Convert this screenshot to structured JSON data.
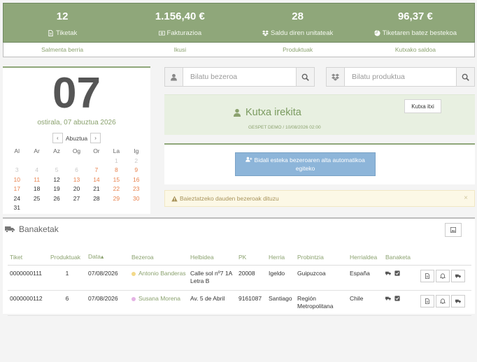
{
  "stats": [
    {
      "value": "12",
      "label": "Tiketak",
      "icon": "file-icon"
    },
    {
      "value": "1.156,40 €",
      "label": "Fakturazioa",
      "icon": "money-icon"
    },
    {
      "value": "28",
      "label": "Saldu diren unitateak",
      "icon": "dropbox-icon"
    },
    {
      "value": "96,37 €",
      "label": "Tiketaren batez bestekoa",
      "icon": "pie-chart-icon"
    }
  ],
  "quick_links": [
    "Salmenta berria",
    "Ikusi",
    "Produktuak",
    "Kutxako saldoa"
  ],
  "calendar": {
    "day": "07",
    "date_text": "ostirala, 07 abuztua 2026",
    "month": "Abuztua",
    "prev": "‹",
    "next": "›",
    "weekdays": [
      "Al",
      "Ar",
      "Az",
      "Og",
      "Or",
      "La",
      "Ig"
    ],
    "weeks": [
      [
        "",
        "",
        "",
        "",
        "",
        "1",
        "2"
      ],
      [
        "3",
        "4",
        "5",
        "6",
        "7",
        "8",
        "9"
      ],
      [
        "10",
        "11",
        "12",
        "13",
        "14",
        "15",
        "16"
      ],
      [
        "17",
        "18",
        "19",
        "20",
        "21",
        "22",
        "23"
      ],
      [
        "24",
        "25",
        "26",
        "27",
        "28",
        "29",
        "30"
      ],
      [
        "31",
        "",
        "",
        "",
        "",
        "",
        ""
      ]
    ]
  },
  "search_client": {
    "placeholder": "Bilatu bezeroa"
  },
  "search_product": {
    "placeholder": "Bilatu produktua"
  },
  "kutxa": {
    "title": "Kutxa irekita",
    "subtitle": "GESPET DEMO / 10/08/2026 02:00",
    "close_label": "Kutxa itxi"
  },
  "link_button": {
    "line1": "Bidali esteka bezeroaren alta automatikoa",
    "line2": "egiteko"
  },
  "warning": {
    "text": "Baieztatzeko dauden bezeroak dituzu",
    "close": "×"
  },
  "deliveries": {
    "title": "Banaketak",
    "columns": [
      "Tiket",
      "Produktuak",
      "Data",
      "Bezeroa",
      "Helbidea",
      "PK",
      "Herria",
      "Probintzia",
      "Herrialdea",
      "Banaketa"
    ],
    "sort_indicator": "▴",
    "rows": [
      {
        "ticket": "0000000111",
        "products": "1",
        "date": "07/08/2026",
        "client": "Antonio Banderas",
        "client_color": "#f3d98a",
        "address": "Calle sol nº7 1A Letra B",
        "pk": "20008",
        "town": "Igeldo",
        "province": "Guipuzcoa",
        "country": "España"
      },
      {
        "ticket": "0000000112",
        "products": "6",
        "date": "07/08/2026",
        "client": "Susana Morena",
        "client_color": "#e4b3e4",
        "address": "Av. 5 de Abril",
        "pk": "9161087",
        "town": "Santiago",
        "province": "Región Metropolitana",
        "country": "Chile"
      }
    ]
  },
  "colors": {
    "accent": "#8fa77a",
    "accent_text": "#8ba26f",
    "weekend": "#e8824e",
    "button_blue": "#8db5d9"
  }
}
